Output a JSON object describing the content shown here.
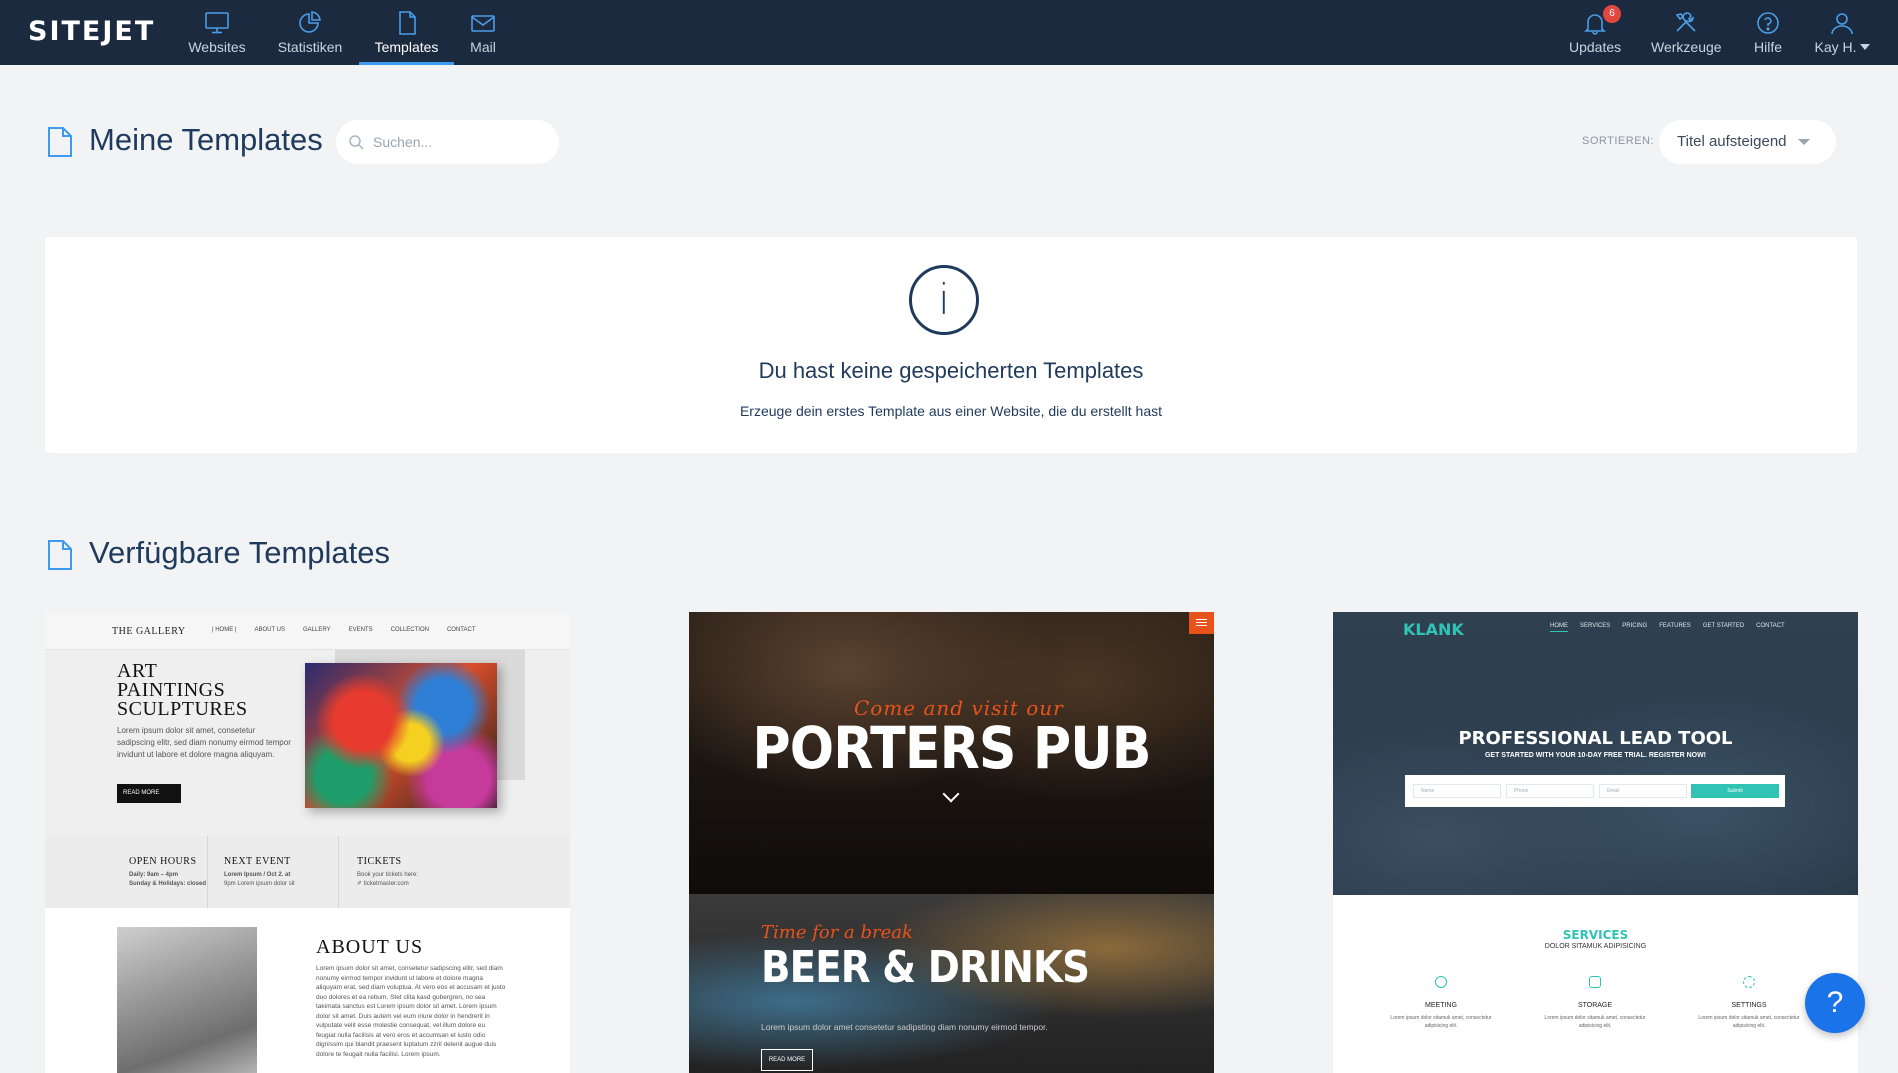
{
  "app": {
    "logo": "SITEJET"
  },
  "nav": {
    "items": [
      {
        "label": "Websites"
      },
      {
        "label": "Statistiken"
      },
      {
        "label": "Templates"
      },
      {
        "label": "Mail"
      }
    ],
    "right": [
      {
        "label": "Updates",
        "badge": "6"
      },
      {
        "label": "Werkzeuge"
      },
      {
        "label": "Hilfe"
      },
      {
        "label": "Kay H."
      }
    ]
  },
  "my_templates": {
    "title": "Meine Templates",
    "search_placeholder": "Suchen...",
    "sort_label": "SORTIEREN:",
    "sort_value": "Titel aufsteigend",
    "empty": {
      "icon_glyph": "i",
      "title": "Du hast keine gespeicherten Templates",
      "subtitle": "Erzeuge dein erstes Template aus einer Website, die du erstellt hast"
    }
  },
  "available": {
    "title": "Verfügbare Templates",
    "gallery": {
      "brand": "THE GALLERY",
      "links": [
        "| HOME |",
        "ABOUT US",
        "GALLERY",
        "EVENTS",
        "COLLECTION",
        "CONTACT"
      ],
      "hero_lines": [
        "ART",
        "PAINTINGS",
        "SCULPTURES"
      ],
      "hero_text": "Lorem ipsum dolor sit amet, consetetur sadipscing elitr, sed diam nonumy eirmod tempor invidunt ut labore et dolore magna aliquyam.",
      "button": "READ MORE",
      "info": [
        {
          "title": "OPEN HOURS",
          "line1": "Daily: 9am – 4pm",
          "line2": "Sunday & Holidays: closed"
        },
        {
          "title": "NEXT EVENT",
          "line1": "Lorem Ipsum / Oct 2. at",
          "line2": "9pm Lorem ipsum dolor sit"
        },
        {
          "title": "TICKETS",
          "line1": "Book your tickets here:",
          "line2": "✐ ticketmaster.com"
        }
      ],
      "about_title": "ABOUT US",
      "about_text": "Lorem ipsum dolor sit amet, consetetur sadipscing elitr, sed diam nonumy eirmod tempor invidunt ut labore et dolore magna aliquyam erat, sed diam voluptua. At vero eos et accusam et justo duo dolores et ea rebum. Stet clita kasd gubergren, no sea takimata sanctus est Lorem ipsum dolor sit amet. Lorem ipsum dolor sit amet. Duis autem vel eum iriure dolor in hendrerit in vulputate velit esse molestie consequat, vel illum dolore eu feugiat nulla facilisis at vero eros et accumsan et iusto odio dignissim qui blandit praesent luptatum zzril delenit augue duis dolore te feugait nulla facilisi. Lorem ipsum."
    },
    "pub": {
      "script": "Come and visit our",
      "title": "PORTERS PUB",
      "script2": "Time for a break",
      "title2": "BEER & DRINKS",
      "text": "Lorem ipsum dolor amet consetetur sadipsting diam nonumy eirmod tempor.",
      "button": "READ MORE"
    },
    "klank": {
      "logo": "KLANK",
      "links": [
        "HOME",
        "SERVICES",
        "PRICING",
        "FEATURES",
        "GET STARTED",
        "CONTACT"
      ],
      "title": "PROFESSIONAL LEAD TOOL",
      "subtitle": "GET STARTED WITH YOUR 10-DAY FREE TRIAL. REGISTER NOW!",
      "fields": [
        "Name",
        "Phone",
        "Email"
      ],
      "submit": "Submit",
      "services_title": "SERVICES",
      "services_sub": "DOLOR SITAMUK ADIPISICING",
      "features": [
        {
          "title": "MEETING",
          "text": "Lorem ipsum dolor sitamuk amet, consectetur adipisicing elit."
        },
        {
          "title": "STORAGE",
          "text": "Lorem ipsum dolor sitamuk amet, consectetur adipisicing elit."
        },
        {
          "title": "SETTINGS",
          "text": "Lorem ipsum dolor sitamuk amet, consectetur adipisicing elit."
        }
      ]
    }
  },
  "help_fab": {
    "label": "?"
  },
  "colors": {
    "nav_bg": "#1b2a3e",
    "accent": "#3d9af0",
    "heading": "#1f3a5c",
    "badge": "#e2473f",
    "fab": "#1a73e8",
    "klank": "#31c4b4",
    "pub": "#e8531b"
  }
}
